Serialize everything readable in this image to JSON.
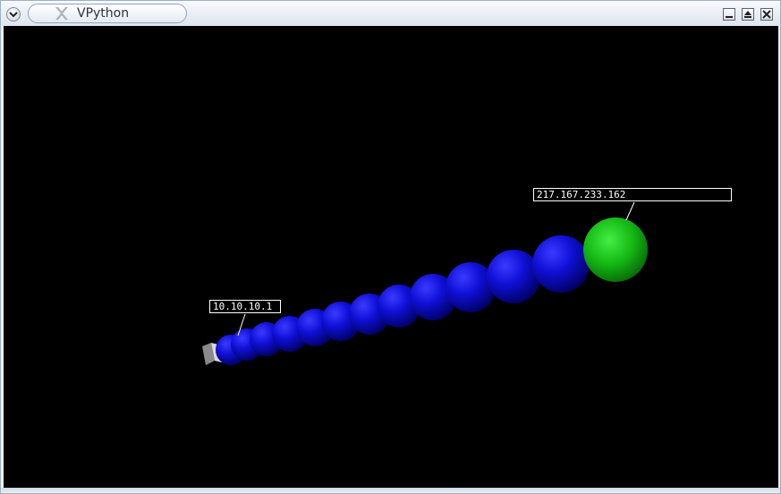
{
  "window": {
    "title": "VPython",
    "background_color": "#000000",
    "controls": [
      "minimize",
      "maximize",
      "close"
    ]
  },
  "scene": {
    "start_node": {
      "label": "10.10.10.1",
      "color": "#0000ff"
    },
    "end_node": {
      "label": "217.167.233.162",
      "color": "#00cc00"
    },
    "hop_sphere_color": "#0000cc",
    "origin_box_color": "#9a9a9a",
    "label_border_color": "#ffffff"
  }
}
